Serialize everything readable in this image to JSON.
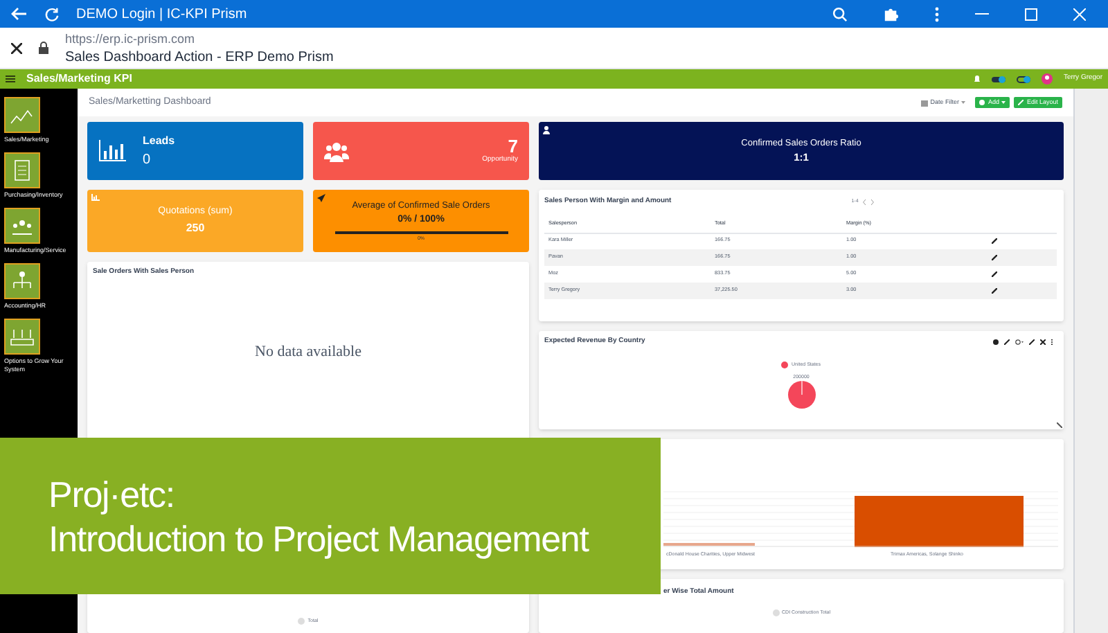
{
  "browser": {
    "tab_title": "DEMO Login | IC-KPI Prism",
    "url": "https://erp.ic-prism.com",
    "page_title": "Sales Dashboard Action - ERP Demo Prism"
  },
  "app_bar": {
    "title": "Sales/Marketing KPI",
    "user": "Terry Gregor"
  },
  "sidebar": {
    "items": [
      {
        "label": "Sales/Marketing"
      },
      {
        "label": "Purchasing/Inventory"
      },
      {
        "label": "Manufacturing/Service"
      },
      {
        "label": "Accounting/HR"
      },
      {
        "label": "Options to Grow Your System"
      }
    ]
  },
  "dashboard": {
    "title": "Sales/Marketting Dashboard",
    "date_filter": "Date Filter",
    "add_button": "Add",
    "edit_button": "Edit Layout"
  },
  "cards": {
    "leads": {
      "label": "Leads",
      "value": "0"
    },
    "opportunity": {
      "value": "7",
      "label": "Opportunity"
    },
    "ratio": {
      "label": "Confirmed Sales Orders Ratio",
      "value": "1:1"
    },
    "quotations": {
      "label": "Quotations (sum)",
      "value": "250"
    },
    "average": {
      "label": "Average of Confirmed Sale Orders",
      "value": "0% / 100%",
      "level": 0,
      "reading": "0%"
    }
  },
  "sale_orders": {
    "title": "Sale Orders With Sales Person",
    "empty": "No data available"
  },
  "sales_person_table": {
    "title": "Sales Person With Margin and Amount",
    "pager": "1-4",
    "columns": [
      "Salesperson",
      "Total",
      "Margin (%)"
    ],
    "rows": [
      [
        "Kara Miller",
        "166.75",
        "1.00"
      ],
      [
        "Pavan",
        "166.75",
        "1.00"
      ],
      [
        "Moz",
        "833.75",
        "5.00"
      ],
      [
        "Terry Gregory",
        "37,225.50",
        "3.00"
      ]
    ]
  },
  "revenue_by_country": {
    "title": "Expected Revenue By Country",
    "legend": "United States",
    "slice_label": "200000"
  },
  "bar_panel": {
    "labels": [
      "cDonald House Charities, Upper Midwest",
      "Trimax Americas, Solange Shinko"
    ]
  },
  "bottom_left": {
    "legend": "Total"
  },
  "bottom_right": {
    "title": "er Wise Total Amount",
    "legend": "CDI Construction Total"
  },
  "banner": {
    "lines": [
      "Proj·etc:",
      "Introduction to Project Management"
    ]
  }
}
